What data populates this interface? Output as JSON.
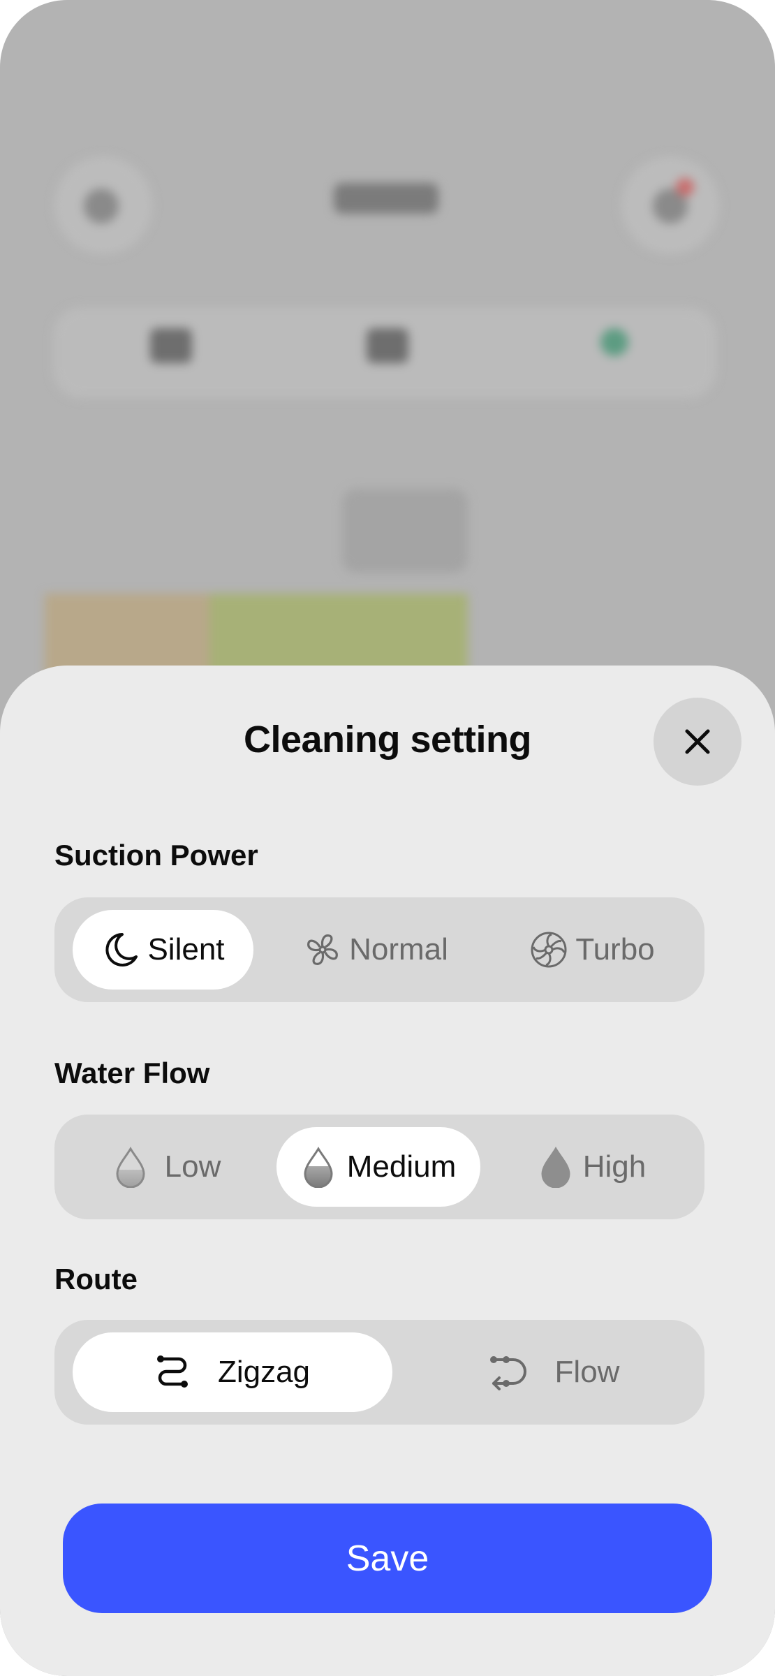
{
  "sheet": {
    "title": "Cleaning setting",
    "close_icon": "close-icon"
  },
  "suction": {
    "label": "Suction Power",
    "options": [
      {
        "label": "Silent",
        "icon": "moon-icon",
        "selected": true
      },
      {
        "label": "Normal",
        "icon": "fan-icon",
        "selected": false
      },
      {
        "label": "Turbo",
        "icon": "turbo-fan-icon",
        "selected": false
      }
    ]
  },
  "water": {
    "label": "Water Flow",
    "options": [
      {
        "label": "Low",
        "icon": "drop-low-icon",
        "selected": false
      },
      {
        "label": "Medium",
        "icon": "drop-medium-icon",
        "selected": true
      },
      {
        "label": "High",
        "icon": "drop-high-icon",
        "selected": false
      }
    ]
  },
  "route": {
    "label": "Route",
    "options": [
      {
        "label": "Zigzag",
        "icon": "zigzag-route-icon",
        "selected": true
      },
      {
        "label": "Flow",
        "icon": "flow-route-icon",
        "selected": false
      }
    ]
  },
  "save_label": "Save",
  "colors": {
    "accent": "#3a55ff",
    "sheet_bg": "#ebebeb",
    "segment_bg": "#d8d8d8",
    "selected_bg": "#ffffff",
    "backdrop": "#b3b3b3"
  }
}
